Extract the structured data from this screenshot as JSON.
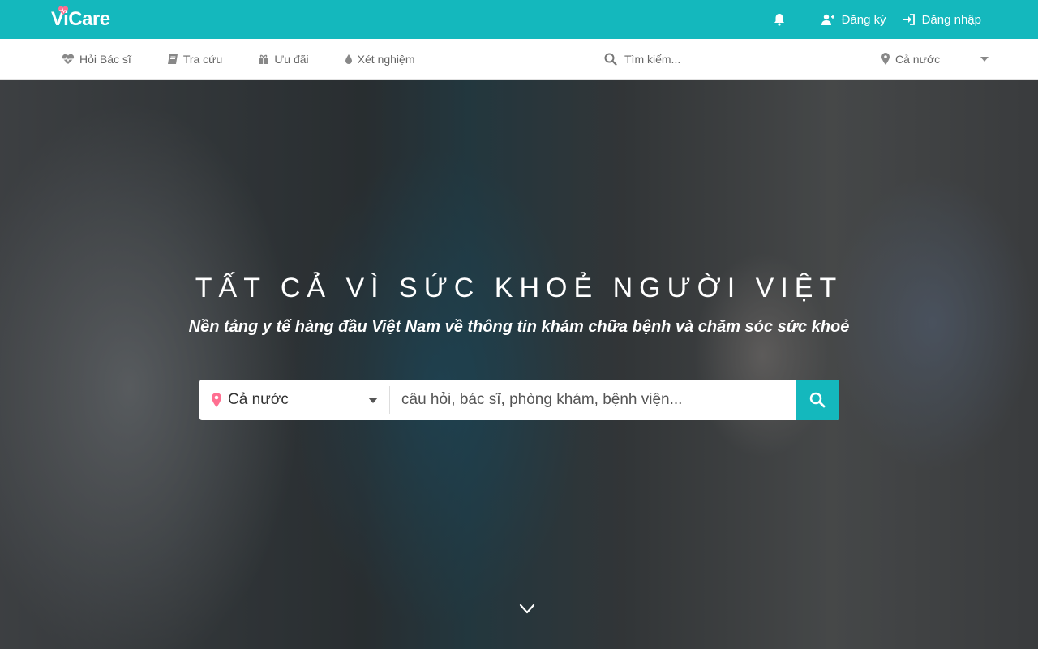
{
  "brand": {
    "name": "ViCare",
    "color": "#14b8bd",
    "heart_color": "#ff6f91"
  },
  "top_bar": {
    "bell_icon": "bell-icon",
    "register_label": "Đăng ký",
    "login_label": "Đăng nhập"
  },
  "nav": {
    "items": [
      {
        "label": "Hỏi Bác sĩ",
        "icon": "heartbeat-icon"
      },
      {
        "label": "Tra cứu",
        "icon": "book-icon"
      },
      {
        "label": "Ưu đãi",
        "icon": "gift-icon"
      },
      {
        "label": "Xét nghiệm",
        "icon": "drop-icon"
      }
    ],
    "search_placeholder": "Tìm kiếm...",
    "location_label": "Cả nước"
  },
  "hero": {
    "title": "TẤT CẢ VÌ SỨC KHOẺ NGƯỜI VIỆT",
    "subtitle": "Nền tảng y tế hàng đầu Việt Nam về thông tin khám chữa bệnh và chăm sóc sức khoẻ",
    "search": {
      "location_label": "Cả nước",
      "placeholder": "câu hỏi, bác sĩ, phòng khám, bệnh viện..."
    }
  }
}
